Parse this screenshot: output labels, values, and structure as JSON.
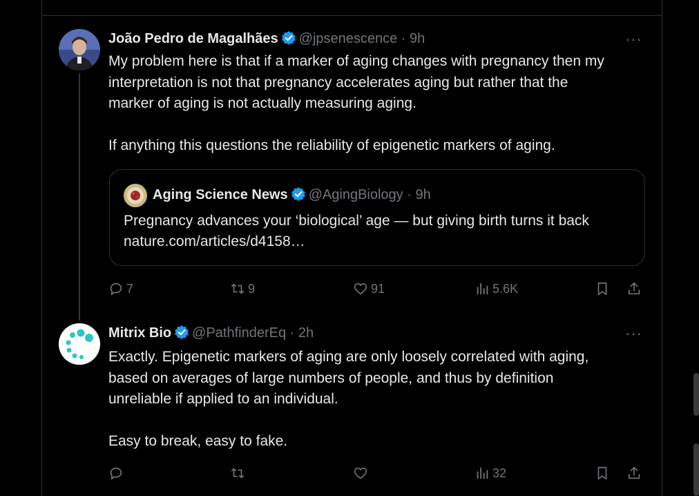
{
  "tweets": [
    {
      "author_name": "João Pedro de Magalhães",
      "handle_time": "@jpsenescence · 9h",
      "more": "···",
      "text_lines": [
        "My problem here is that if a marker of aging changes with pregnancy then my",
        "interpretation is not that pregnancy accelerates aging but rather that the",
        "marker of aging is not actually measuring aging.",
        "",
        "If anything this questions the reliability of epigenetic markers of aging."
      ],
      "quote": {
        "author_name": "Aging Science News",
        "handle_time": "@AgingBiology · 9h",
        "text_lines": [
          "Pregnancy advances your ‘biological’ age — but giving birth turns it back",
          "nature.com/articles/d4158…"
        ]
      },
      "actions": {
        "replies": "7",
        "retweets": "9",
        "likes": "91",
        "views": "5.6K"
      }
    },
    {
      "author_name": "Mitrix Bio",
      "handle_time": "@PathfinderEq · 2h",
      "more": "···",
      "text_lines": [
        "Exactly.  Epigenetic markers of aging are only loosely correlated with aging,",
        "based on averages of large numbers of people, and thus by definition",
        "unreliable if applied to an individual.",
        "",
        "Easy to break, easy to fake."
      ],
      "actions": {
        "replies": "",
        "retweets": "",
        "likes": "",
        "views": "32"
      }
    }
  ],
  "colors": {
    "background": "#000000",
    "text": "#e7e9ea",
    "muted": "#71767b",
    "border": "#2f3336",
    "verified": "#1d9bf0",
    "mitrix_teal": "#2ec4c9"
  },
  "icons": [
    "reply-icon",
    "retweet-icon",
    "like-icon",
    "views-icon",
    "bookmark-icon",
    "share-icon",
    "verified-badge-icon",
    "more-icon"
  ]
}
